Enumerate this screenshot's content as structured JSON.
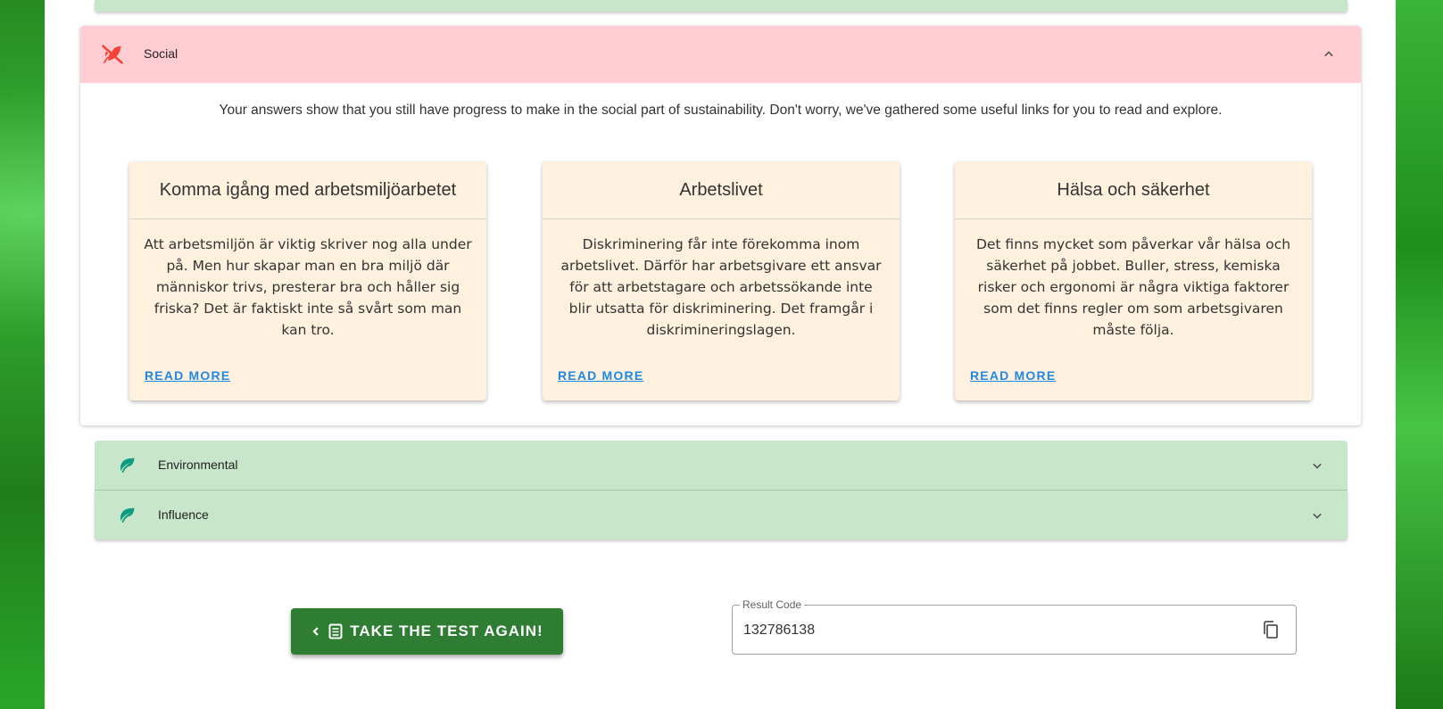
{
  "social": {
    "title": "Social",
    "intro": "Your answers show that you still have progress to make in the social part of sustainability. Don't worry, we've gathered some useful links for you to read and explore.",
    "header_color": "#ffcdd2",
    "icon": "leaf-off-icon",
    "cards": [
      {
        "title": "Komma igång med arbetsmiljöarbetet",
        "body": "Att arbetsmiljön är viktig skriver nog alla under på. Men hur skapar man en bra miljö där människor trivs, presterar bra och håller sig friska? Det är faktiskt inte så svårt som man kan tro.",
        "link": "READ MORE"
      },
      {
        "title": "Arbetslivet",
        "body": "Diskriminering får inte förekomma inom arbetslivet. Därför har arbetsgivare ett ansvar för att arbetstagare och arbetssökande inte blir utsatta för diskriminering. Det framgår i diskrimineringslagen.",
        "link": "READ MORE"
      },
      {
        "title": "Hälsa och säkerhet",
        "body": "Det finns mycket som påverkar vår hälsa och säkerhet på jobbet. Buller, stress, kemiska risker och ergonomi är några viktiga faktorer som det finns regler om som arbetsgivaren måste följa.",
        "link": "READ MORE"
      }
    ]
  },
  "accordions": [
    {
      "title": "Environmental",
      "icon": "leaf-icon"
    },
    {
      "title": "Influence",
      "icon": "leaf-icon"
    }
  ],
  "actions": {
    "take_test_again": "TAKE THE TEST AGAIN!"
  },
  "result": {
    "label": "Result Code",
    "code": "132786138"
  },
  "colors": {
    "success_green": "#2e7d32",
    "panel_green": "#c8e6c9",
    "card_bg": "#fff1de",
    "link_blue": "#1e88e5",
    "leaf_teal": "#0e9a7f",
    "danger_red": "#f44336"
  }
}
